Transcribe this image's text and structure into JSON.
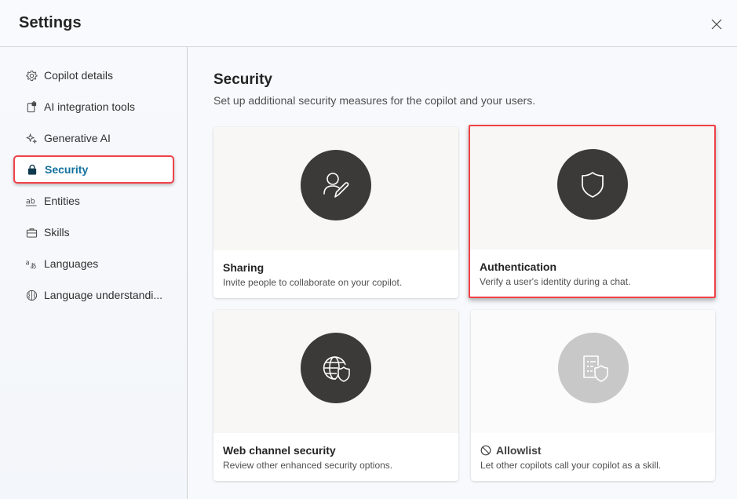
{
  "header": {
    "title": "Settings",
    "close_icon": "close-icon"
  },
  "sidebar": {
    "items": [
      {
        "label": "Copilot details",
        "icon": "gear-icon",
        "active": false
      },
      {
        "label": "AI integration tools",
        "icon": "integration-tools-icon",
        "active": false
      },
      {
        "label": "Generative AI",
        "icon": "sparkle-icon",
        "active": false
      },
      {
        "label": "Security",
        "icon": "lock-icon",
        "active": true
      },
      {
        "label": "Entities",
        "icon": "text-ab-icon",
        "active": false
      },
      {
        "label": "Skills",
        "icon": "briefcase-icon",
        "active": false
      },
      {
        "label": "Languages",
        "icon": "translate-icon",
        "active": false
      },
      {
        "label": "Language understandi...",
        "icon": "brain-icon",
        "active": false
      }
    ]
  },
  "main": {
    "title": "Security",
    "subtitle": "Set up additional security measures for the copilot and your users.",
    "cards": [
      {
        "title": "Sharing",
        "description": "Invite people to collaborate on your copilot.",
        "icon": "person-edit-icon",
        "highlighted": false,
        "disabled": false
      },
      {
        "title": "Authentication",
        "description": "Verify a user's identity during a chat.",
        "icon": "shield-icon",
        "highlighted": true,
        "disabled": false
      },
      {
        "title": "Web channel security",
        "description": "Review other enhanced security options.",
        "icon": "globe-shield-icon",
        "highlighted": false,
        "disabled": false
      },
      {
        "title": "Allowlist",
        "description": "Let other copilots call your copilot as a skill.",
        "icon": "document-shield-icon",
        "status_icon": "blocked-icon",
        "highlighted": false,
        "disabled": true
      }
    ]
  },
  "colors": {
    "accent_text": "#11709d",
    "highlight_border": "#ef4248",
    "icon_circle": "#3b3a39",
    "icon_circle_disabled": "#c8c8c8"
  }
}
